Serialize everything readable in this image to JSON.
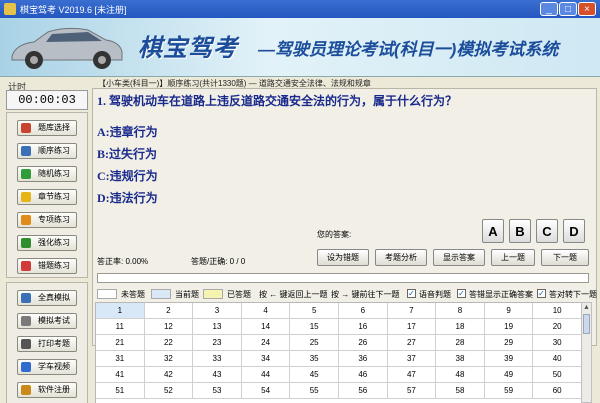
{
  "window": {
    "title": "棋宝驾考 V2019.6 [未注册]"
  },
  "banner": {
    "brand": "棋宝驾考",
    "subtitle": "—驾驶员理论考试(科目一)模拟考试系统"
  },
  "timer": {
    "label": "计时",
    "value": "00:00:03"
  },
  "nav": {
    "group1": [
      {
        "label": "题库选择",
        "icon": "database-icon",
        "color": "#c8442e"
      },
      {
        "label": "顺序练习",
        "icon": "list-icon",
        "color": "#3b6fb6"
      },
      {
        "label": "随机练习",
        "icon": "shuffle-icon",
        "color": "#2f9d3a"
      },
      {
        "label": "章节练习",
        "icon": "chapter-icon",
        "color": "#e7b416"
      },
      {
        "label": "专项练习",
        "icon": "check-icon",
        "color": "#e08b1a"
      },
      {
        "label": "强化练习",
        "icon": "plus-icon",
        "color": "#2f8f2f"
      },
      {
        "label": "错题练习",
        "icon": "flag-icon",
        "color": "#d23a3a"
      }
    ],
    "group2": [
      {
        "label": "全真模拟",
        "icon": "exam-icon",
        "color": "#3b6fb6"
      },
      {
        "label": "模拟考试",
        "icon": "paper-icon",
        "color": "#7a7a7a"
      },
      {
        "label": "打印考题",
        "icon": "print-icon",
        "color": "#555555"
      },
      {
        "label": "学车视频",
        "icon": "video-icon",
        "color": "#2f6bd0"
      },
      {
        "label": "软件注册",
        "icon": "key-icon",
        "color": "#c98a1a"
      }
    ]
  },
  "breadcrumb": "【小车类(科目一)】顺序练习(共计1330题) — 道路交通安全法律、法规和规章",
  "question": {
    "text": "1. 驾驶机动车在道路上违反道路交通安全法的行为，属于什么行为？",
    "options": [
      {
        "key": "A",
        "text": "A:违章行为"
      },
      {
        "key": "B",
        "text": "B:过失行为"
      },
      {
        "key": "C",
        "text": "C:违规行为"
      },
      {
        "key": "D",
        "text": "D:违法行为"
      }
    ]
  },
  "answer": {
    "label": "您的答案:",
    "buttons": [
      "A",
      "B",
      "C",
      "D"
    ]
  },
  "stats": {
    "accuracy": "答正率: 0.00%",
    "answered": "答题/正确: 0 / 0"
  },
  "actions": [
    "设为错题",
    "考题分析",
    "显示答案",
    "上一题",
    "下一题"
  ],
  "progress": {
    "value": 0.0
  },
  "legend": {
    "unanswered": "未答题",
    "current": "当前题",
    "answered": "已答题",
    "hint_prev": "按 ← 键返回上一题",
    "hint_next": "按 → 键前往下一题",
    "checks": [
      {
        "label": "语音判题",
        "checked": true
      },
      {
        "label": "答错显示正确答案",
        "checked": true
      },
      {
        "label": "答对转下一题",
        "checked": true
      }
    ],
    "colors": {
      "unanswered": "#ffffff",
      "current": "#d9e8f6",
      "answered": "#f6f2b0"
    }
  },
  "grid_rows": [
    [
      "1",
      "2",
      "3",
      "4",
      "5",
      "6",
      "7",
      "8",
      "9",
      "10"
    ],
    [
      "11",
      "12",
      "13",
      "14",
      "15",
      "16",
      "17",
      "18",
      "19",
      "20"
    ],
    [
      "21",
      "22",
      "23",
      "24",
      "25",
      "26",
      "27",
      "28",
      "29",
      "30"
    ],
    [
      "31",
      "32",
      "33",
      "34",
      "35",
      "36",
      "37",
      "38",
      "39",
      "40"
    ],
    [
      "41",
      "42",
      "43",
      "44",
      "45",
      "46",
      "47",
      "48",
      "49",
      "50"
    ],
    [
      "51",
      "52",
      "53",
      "54",
      "55",
      "56",
      "57",
      "58",
      "59",
      "60"
    ]
  ]
}
